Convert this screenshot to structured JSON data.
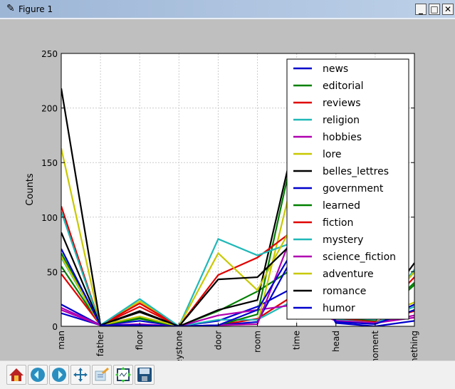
{
  "window": {
    "title": "Figure 1",
    "icon": "feather-icon",
    "controls": [
      "minimize",
      "maximize",
      "close"
    ]
  },
  "toolbar": {
    "buttons": [
      "home",
      "back",
      "forward",
      "pan",
      "configure-subplots",
      "zoom-to-rect",
      "save"
    ]
  },
  "chart_data": {
    "type": "line",
    "title": "",
    "xlabel": "",
    "ylabel": "Counts",
    "ylim": [
      0,
      250
    ],
    "yticks": [
      0,
      50,
      100,
      150,
      200,
      250
    ],
    "grid": true,
    "legend_placement": "upper-right",
    "categories": [
      "man",
      "father",
      "floor",
      "keystone",
      "door",
      "room",
      "time",
      "head",
      "moment",
      "something"
    ],
    "series": [
      {
        "name": "news",
        "color": "#0000cc",
        "values": [
          20,
          1,
          5,
          0,
          5,
          18,
          37,
          6,
          3,
          20
        ]
      },
      {
        "name": "editorial",
        "color": "#008000",
        "values": [
          55,
          1,
          8,
          0,
          14,
          32,
          55,
          8,
          5,
          38
        ]
      },
      {
        "name": "reviews",
        "color": "#e00000",
        "values": [
          48,
          1,
          18,
          0,
          1,
          7,
          30,
          7,
          4,
          14
        ]
      },
      {
        "name": "religion",
        "color": "#20b8b8",
        "values": [
          63,
          1,
          9,
          0,
          6,
          6,
          25,
          6,
          3,
          18
        ]
      },
      {
        "name": "hobbies",
        "color": "#b000b0",
        "values": [
          17,
          1,
          2,
          0,
          10,
          15,
          20,
          5,
          3,
          8
        ]
      },
      {
        "name": "lore",
        "color": "#c8c800",
        "values": [
          163,
          1,
          23,
          0,
          1,
          2,
          150,
          9,
          7,
          22
        ]
      },
      {
        "name": "belles_lettres",
        "color": "#000000",
        "values": [
          218,
          1,
          13,
          0,
          15,
          24,
          180,
          10,
          8,
          50
        ]
      },
      {
        "name": "government",
        "color": "#0000cc",
        "values": [
          12,
          1,
          1,
          0,
          1,
          4,
          70,
          3,
          0,
          5
        ]
      },
      {
        "name": "learned",
        "color": "#008000",
        "values": [
          67,
          1,
          7,
          0,
          1,
          11,
          175,
          8,
          6,
          40
        ]
      },
      {
        "name": "fiction",
        "color": "#e00000",
        "values": [
          110,
          1,
          21,
          0,
          47,
          63,
          90,
          9,
          7,
          45
        ]
      },
      {
        "name": "mystery",
        "color": "#20b8b8",
        "values": [
          105,
          1,
          25,
          0,
          80,
          65,
          78,
          9,
          6,
          52
        ]
      },
      {
        "name": "science_fiction",
        "color": "#b000b0",
        "values": [
          15,
          1,
          1,
          0,
          1,
          2,
          95,
          5,
          3,
          10
        ]
      },
      {
        "name": "adventure",
        "color": "#c8c800",
        "values": [
          64,
          1,
          9,
          0,
          67,
          33,
          100,
          10,
          8,
          50
        ]
      },
      {
        "name": "romance",
        "color": "#000000",
        "values": [
          86,
          1,
          14,
          0,
          43,
          45,
          80,
          10,
          9,
          58
        ]
      },
      {
        "name": "humor",
        "color": "#0000cc",
        "values": [
          71,
          1,
          1,
          0,
          1,
          15,
          75,
          4,
          2,
          15
        ]
      }
    ]
  }
}
